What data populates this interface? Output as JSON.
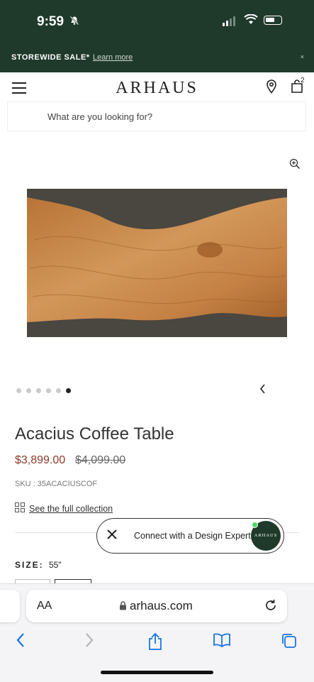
{
  "status_bar": {
    "time": "9:59"
  },
  "promo": {
    "title": "STOREWIDE SALE*",
    "link": "Learn more",
    "close": "×"
  },
  "header": {
    "logo": "ARHAUS",
    "cart_count": "2"
  },
  "search": {
    "placeholder": "What are you looking for?"
  },
  "gallery": {
    "dot_count": 6,
    "active_dot": 5
  },
  "product": {
    "title": "Acacius Coffee Table",
    "price": "$3,899.00",
    "original_price": "$4,099.00",
    "sku": "SKU : 35ACACIUSCOF",
    "collection_link": "See the full collection"
  },
  "expert": {
    "label": "Connect with a Design Expert",
    "avatar_text": "ARHAUS"
  },
  "options": {
    "size_label": "SIZE:",
    "size_value": "55\""
  },
  "safari": {
    "text_size": "AA",
    "url": "arhaus.com"
  },
  "colors": {
    "brand_green": "#1f3a2b",
    "sale_price": "#8b3a2b"
  }
}
